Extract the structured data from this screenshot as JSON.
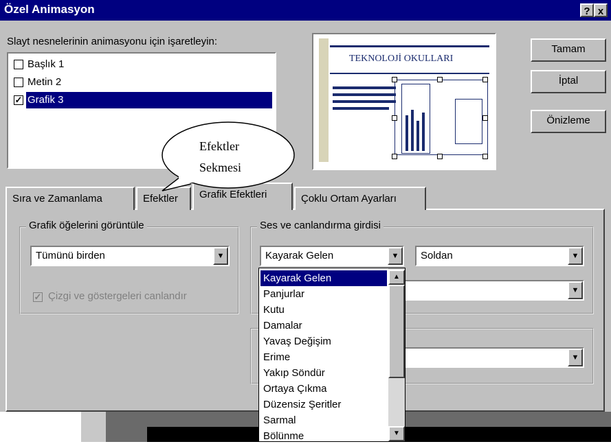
{
  "window": {
    "title": "Özel Animasyon",
    "help_label": "?",
    "close_label": "x"
  },
  "objects_label": "Slayt nesnelerinin animasyonu için işaretleyin:",
  "objects": [
    {
      "label": "Başlık 1",
      "checked": false
    },
    {
      "label": "Metin 2",
      "checked": false
    },
    {
      "label": "Grafik 3",
      "checked": true
    }
  ],
  "check_glyph": "✓",
  "preview": {
    "title": "TEKNOLOJİ OKULLARI"
  },
  "buttons": {
    "ok": "Tamam",
    "cancel": "İptal",
    "preview": "Önizleme"
  },
  "callout": {
    "line1": "Efektler",
    "line2": "Sekmesi"
  },
  "tabs": [
    {
      "label": "Sıra ve Zamanlama"
    },
    {
      "label": "Efektler"
    },
    {
      "label": "Grafik Efektleri",
      "active": true
    },
    {
      "label": "Çoklu Ortam Ayarları"
    }
  ],
  "chart_group": {
    "label": "Grafik öğelerini görüntüle",
    "combo_value": "Tümünü birden",
    "checkbox_label": "Çizgi ve göstergeleri canlandır"
  },
  "effect_group": {
    "label": "Ses ve canlandırma girdisi",
    "effect_value": "Kayarak Gelen",
    "direction_value": "Soldan"
  },
  "dropdown": {
    "items": [
      "Kayarak Gelen",
      "Panjurlar",
      "Kutu",
      "Damalar",
      "Yavaş Değişim",
      "Erime",
      "Yakıp Söndür",
      "Ortaya Çıkma",
      "Düzensiz Şeritler",
      "Sarmal",
      "Bölünme"
    ],
    "selected_index": 0
  },
  "icons": {
    "arrow_down": "▼",
    "arrow_up": "▲"
  },
  "colors": {
    "title_bar": "#000080",
    "selection": "#000080",
    "dialog_face": "#c0c0c0"
  }
}
